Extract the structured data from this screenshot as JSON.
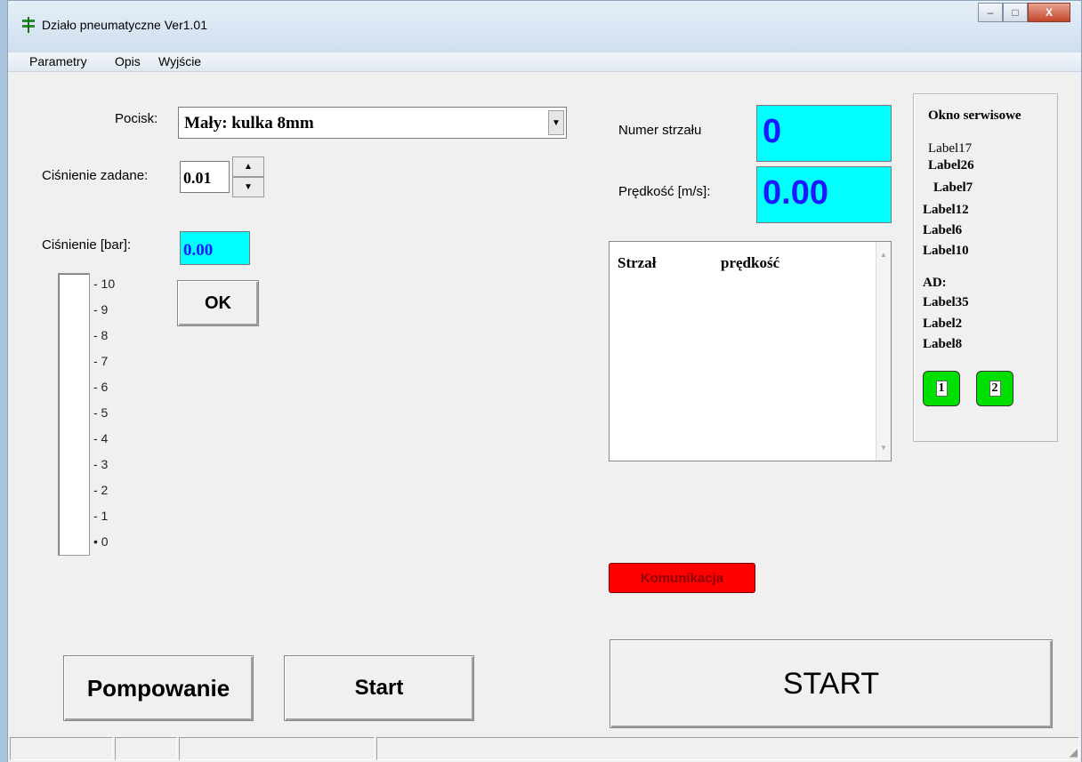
{
  "window": {
    "title": "Działo pneumatyczne   Ver1.01",
    "minimize": "–",
    "maximize": "□",
    "close": "X"
  },
  "menu": [
    "Parametry",
    "Opis",
    "Wyjście"
  ],
  "projectile": {
    "label": "Pocisk:",
    "value": "Mały: kulka 8mm"
  },
  "set_pressure": {
    "label": "Ciśnienie zadane:",
    "value": "0.01"
  },
  "pressure": {
    "label": "Ciśnienie [bar]:",
    "value": "0.00"
  },
  "gauge": {
    "ticks": [
      "- 10",
      "- 9",
      "- 8",
      "- 7",
      "- 6",
      "- 5",
      "- 4",
      "- 3",
      "- 2",
      "- 1",
      "• 0"
    ],
    "level": 0
  },
  "ok_label": "OK",
  "shot_number": {
    "label": "Numer strzału",
    "value": "0"
  },
  "speed": {
    "label": "Prędkość [m/s]:",
    "value": "0.00"
  },
  "shots_list": {
    "col_shot": "Strzał",
    "col_speed": "prędkość"
  },
  "komunikacja": "Komunikacja",
  "service": {
    "title": "Okno serwisowe",
    "labels": [
      "Label17",
      "Label26",
      "Label7",
      "Label12",
      "Label6",
      "Label10"
    ],
    "ad_title": "AD:",
    "ad_labels": [
      "Label35",
      "Label2",
      "Label8"
    ],
    "btn1": "1",
    "btn2": "2"
  },
  "buttons": {
    "pump": "Pompowanie",
    "start": "Start",
    "big_start": "START"
  },
  "colors": {
    "cyan": "#00ffff",
    "value_blue": "#1a1aff",
    "alert_red": "#ff0000",
    "green": "#00e000"
  }
}
